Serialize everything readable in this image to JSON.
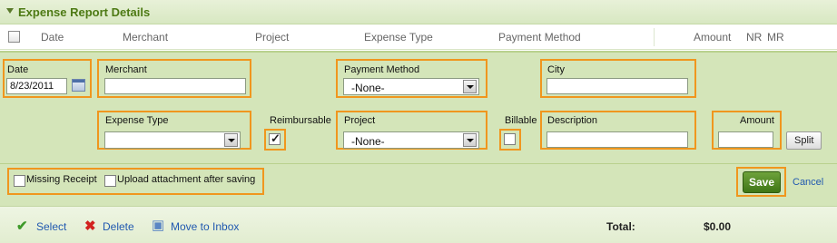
{
  "panel": {
    "title": "Expense Report Details"
  },
  "columns": {
    "date": "Date",
    "merchant": "Merchant",
    "project": "Project",
    "expense_type": "Expense Type",
    "payment_method": "Payment Method",
    "amount": "Amount",
    "nr": "NR",
    "mr": "MR"
  },
  "form": {
    "date": {
      "label": "Date",
      "value": "8/23/2011"
    },
    "merchant": {
      "label": "Merchant",
      "value": ""
    },
    "payment_method": {
      "label": "Payment Method",
      "selected": "-None-"
    },
    "city": {
      "label": "City",
      "value": ""
    },
    "expense_type": {
      "label": "Expense Type",
      "selected": ""
    },
    "reimbursable": {
      "label": "Reimbursable",
      "checked": true
    },
    "project": {
      "label": "Project",
      "selected": "-None-"
    },
    "billable": {
      "label": "Billable",
      "checked": false
    },
    "description": {
      "label": "Description",
      "value": ""
    },
    "amount": {
      "label": "Amount",
      "value": ""
    },
    "split_label": "Split"
  },
  "options": {
    "missing_receipt": {
      "label": "Missing Receipt",
      "checked": false
    },
    "upload_after_saving": {
      "label": "Upload attachment after saving",
      "checked": false
    }
  },
  "actions": {
    "save": "Save",
    "cancel": "Cancel"
  },
  "footer": {
    "select": "Select",
    "delete": "Delete",
    "move_to_inbox": "Move to Inbox",
    "total_label": "Total:",
    "total_value": "$0.00"
  },
  "colors": {
    "title_text": "#4d7a14",
    "form_background": "#d4e5b9",
    "highlight_border": "#f0961e",
    "save_button": "#4f8a24",
    "link": "#2159b0"
  }
}
